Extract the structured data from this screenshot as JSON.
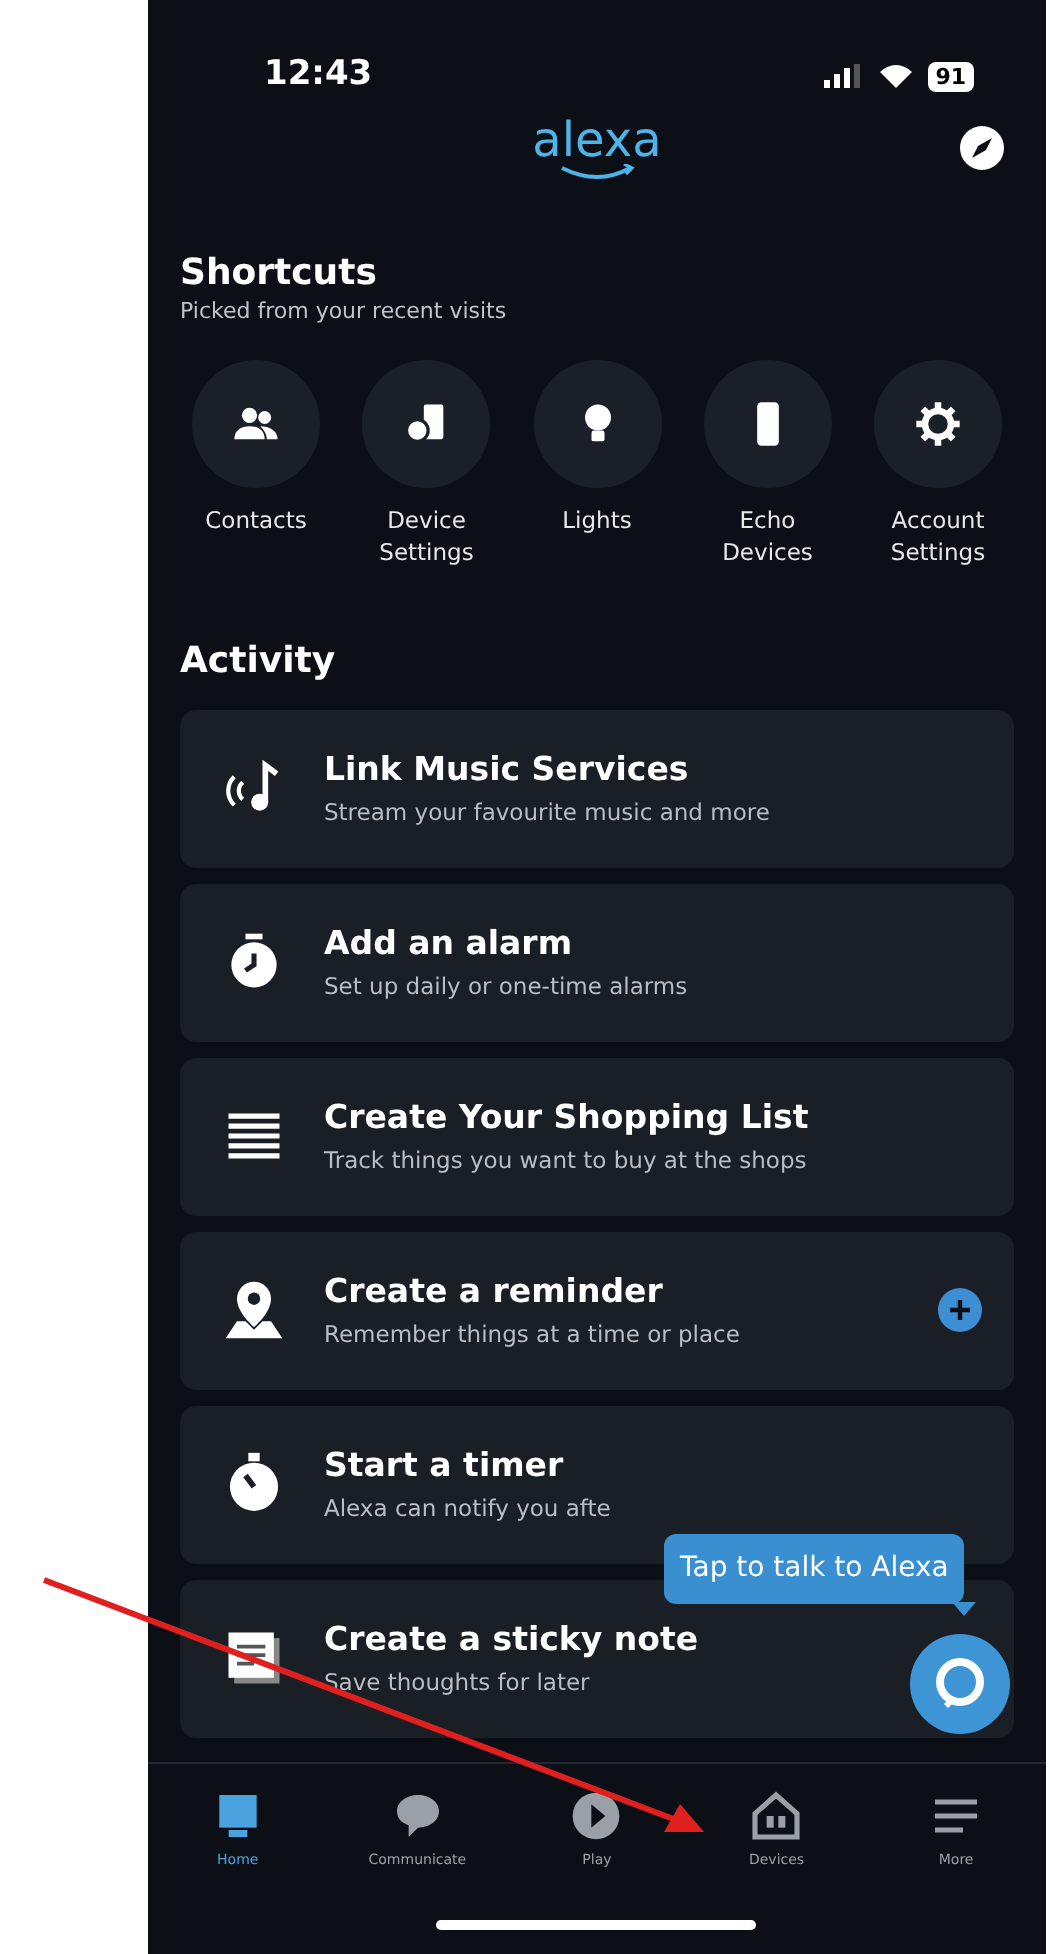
{
  "status_bar": {
    "time": "12:43",
    "battery": "91"
  },
  "header": {
    "logo": "alexa"
  },
  "shortcuts": {
    "title": "Shortcuts",
    "subtitle": "Picked from your recent visits",
    "items": [
      {
        "label": "Contacts",
        "kind": "people"
      },
      {
        "label": "Device Settings",
        "kind": "devices"
      },
      {
        "label": "Lights",
        "kind": "bulb"
      },
      {
        "label": "Echo Devices",
        "kind": "phone"
      },
      {
        "label": "Account Settings",
        "kind": "gear"
      }
    ]
  },
  "activity": {
    "title": "Activity",
    "cards": [
      {
        "kind": "music",
        "title": "Link Music Services",
        "subtitle": "Stream your favourite music and more",
        "add_button": false
      },
      {
        "kind": "alarm",
        "title": "Add an alarm",
        "subtitle": "Set up daily or one-time alarms",
        "add_button": false
      },
      {
        "kind": "list",
        "title": "Create Your Shopping List",
        "subtitle": "Track things you want to buy at the shops",
        "add_button": false
      },
      {
        "kind": "pin",
        "title": "Create a reminder",
        "subtitle": "Remember things at a time or place",
        "add_button": true
      },
      {
        "kind": "timer",
        "title": "Start a timer",
        "subtitle": "Alexa can notify you afte",
        "add_button": false
      },
      {
        "kind": "note",
        "title": "Create a sticky note",
        "subtitle": "Save thoughts for later"
      }
    ]
  },
  "assistant": {
    "tooltip": "Tap to talk to Alexa"
  },
  "nav": [
    {
      "label": "Home",
      "kind": "home",
      "selected": true
    },
    {
      "label": "Communicate",
      "kind": "chat",
      "selected": false
    },
    {
      "label": "Play",
      "kind": "play",
      "selected": false
    },
    {
      "label": "Devices",
      "kind": "house",
      "selected": false
    },
    {
      "label": "More",
      "kind": "menu",
      "selected": false
    }
  ]
}
